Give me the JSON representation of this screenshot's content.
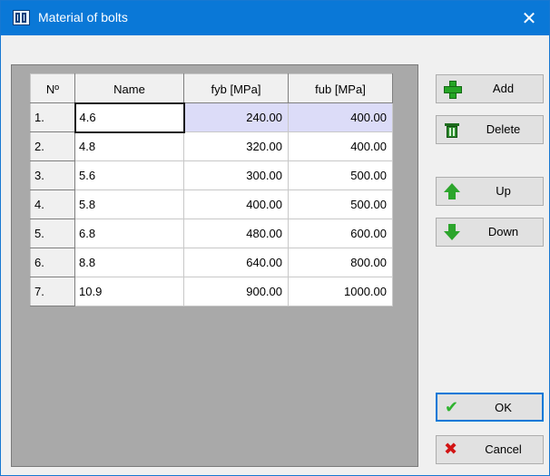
{
  "window": {
    "title": "Material of bolts",
    "close_glyph": "✕"
  },
  "table": {
    "headers": [
      "Nº",
      "Name",
      "fyb [MPa]",
      "fub [MPa]"
    ],
    "rows": [
      {
        "num": "1.",
        "name": "4.6",
        "fyb": "240.00",
        "fub": "400.00"
      },
      {
        "num": "2.",
        "name": "4.8",
        "fyb": "320.00",
        "fub": "400.00"
      },
      {
        "num": "3.",
        "name": "5.6",
        "fyb": "300.00",
        "fub": "500.00"
      },
      {
        "num": "4.",
        "name": "5.8",
        "fyb": "400.00",
        "fub": "500.00"
      },
      {
        "num": "5.",
        "name": "6.8",
        "fyb": "480.00",
        "fub": "600.00"
      },
      {
        "num": "6.",
        "name": "8.8",
        "fyb": "640.00",
        "fub": "800.00"
      },
      {
        "num": "7.",
        "name": "10.9",
        "fyb": "900.00",
        "fub": "1000.00"
      }
    ]
  },
  "buttons": {
    "add": "Add",
    "delete": "Delete",
    "up": "Up",
    "down": "Down",
    "ok": "OK",
    "cancel": "Cancel"
  },
  "icons": {
    "app": "bolt-material-icon",
    "add": "plus-icon",
    "delete": "trash-icon",
    "up": "arrow-up-icon",
    "down": "arrow-down-icon",
    "ok": "check-icon",
    "cancel": "x-icon"
  },
  "colors": {
    "titlebar": "#0a78d7",
    "selected_row": "#dcdcf8",
    "grid_background": "#a9a9a9",
    "default_button_border": "#0078d7"
  }
}
